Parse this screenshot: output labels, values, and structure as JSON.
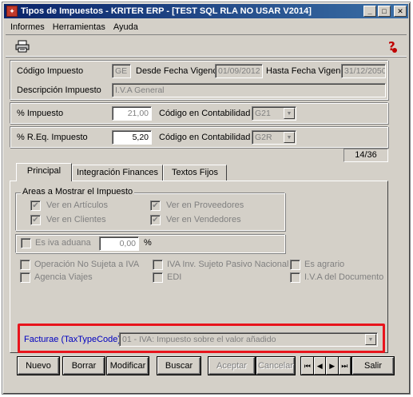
{
  "window": {
    "title": "Tipos de Impuestos - KRITER ERP - [TEST SQL RLA NO USAR V2014]",
    "minimize_glyph": "_",
    "restore_glyph": "□",
    "close_glyph": "✕",
    "title_color": "#0a246a"
  },
  "menu": [
    "Informes",
    "Herramientas",
    "Ayuda"
  ],
  "toolbar": {
    "print_icon": "printer-icon",
    "help_icon": "help-icon"
  },
  "form": {
    "codigo_label": "Código Impuesto",
    "codigo_value": "GE",
    "desde_label": "Desde Fecha Vigencia",
    "desde_value": "01/09/2012",
    "hasta_label": "Hasta Fecha Vigencia",
    "hasta_value": "31/12/2050",
    "descripcion_label": "Descripción Impuesto",
    "descripcion_value": "I.V.A General",
    "pct_label": "% Impuesto",
    "pct_value": "21,00",
    "cont1_label": "Código en Contabilidad",
    "cont1_value": "G21",
    "req_label": "% R.Eq. Impuesto",
    "req_value": "5,20",
    "cont2_label": "Código en Contabilidad",
    "cont2_value": "G2R",
    "counter": "14/36"
  },
  "tabs": [
    "Principal",
    "Integración Finances",
    "Textos Fijos"
  ],
  "principal": {
    "areas_legend": "Areas a Mostrar el Impuesto",
    "ver_articulos": "Ver en Artículos",
    "ver_clientes": "Ver en Clientes",
    "ver_proveedores": "Ver en Proveedores",
    "ver_vendedores": "Ver en Vendedores",
    "es_iva_aduana": "Es iva aduana",
    "aduana_value": "0,00",
    "aduana_pct": "%",
    "operacion_no_sujeta": "Operación No Sujeta a IVA",
    "agencia_viajes": "Agencia Viajes",
    "iva_inv_sujeto": "IVA Inv. Sujeto Pasivo Nacional",
    "edi": "EDI",
    "es_agrario": "Es agrario",
    "iva_documento": "I.V.A del Documento",
    "facturae_label": "Facturae (TaxTypeCode)",
    "facturae_value": "01 - IVA: Impuesto sobre el valor añadido",
    "check_glyph": "✔"
  },
  "buttons": {
    "nuevo": "Nuevo",
    "borrar": "Borrar",
    "modificar": "Modificar",
    "buscar": "Buscar",
    "aceptar": "Aceptar",
    "cancelar": "Cancelar",
    "salir": "Salir",
    "nav_first": "⏮",
    "nav_prev": "◀",
    "nav_next": "▶",
    "nav_last": "⏭"
  },
  "colors": {
    "highlight": "#e8141c",
    "facturae_label": "#0000c0"
  }
}
